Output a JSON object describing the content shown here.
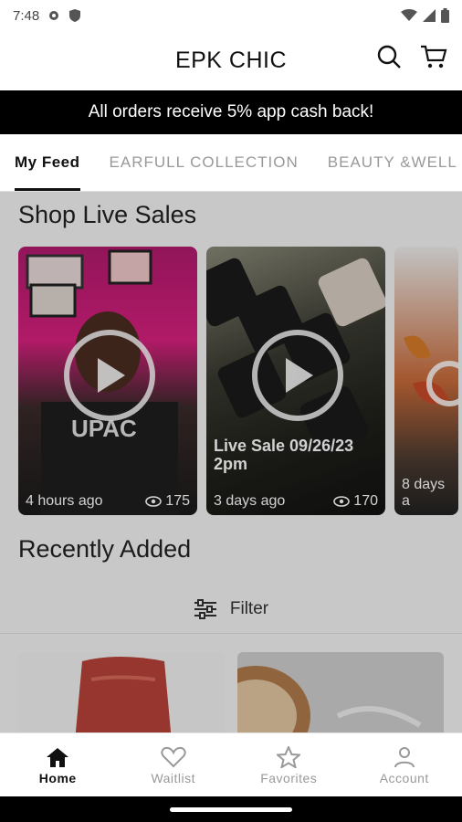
{
  "status_bar": {
    "time": "7:48",
    "left_icons": [
      "gear-icon",
      "shield-icon"
    ],
    "right_icons": [
      "wifi-icon",
      "signal-icon",
      "battery-icon"
    ]
  },
  "header": {
    "title": "EPK CHIC",
    "actions": [
      "search-icon",
      "cart-icon"
    ]
  },
  "banner": {
    "text": "All orders receive 5% app cash back!"
  },
  "tabs": [
    {
      "label": "My Feed",
      "active": true
    },
    {
      "label": "EARFULL COLLECTION",
      "active": false
    },
    {
      "label": "BEAUTY &WELL",
      "active": false
    }
  ],
  "live_sales": {
    "title": "Shop Live Sales",
    "cards": [
      {
        "caption": "",
        "time": "4 hours ago",
        "views": "175"
      },
      {
        "caption": "Live Sale 09/26/23 2pm",
        "time": "3 days ago",
        "views": "170"
      },
      {
        "caption": "",
        "time": "8 days a",
        "views": ""
      }
    ]
  },
  "recently_added": {
    "title": "Recently Added",
    "filter_label": "Filter"
  },
  "bottom_nav": [
    {
      "label": "Home",
      "icon": "home-icon",
      "active": true
    },
    {
      "label": "Waitlist",
      "icon": "heart-icon",
      "active": false
    },
    {
      "label": "Favorites",
      "icon": "star-icon",
      "active": false
    },
    {
      "label": "Account",
      "icon": "person-icon",
      "active": false
    }
  ],
  "colors": {
    "banner_bg": "#000000",
    "feed_bg": "#f4f4f4",
    "active_text": "#111111",
    "inactive_text": "#999999"
  }
}
